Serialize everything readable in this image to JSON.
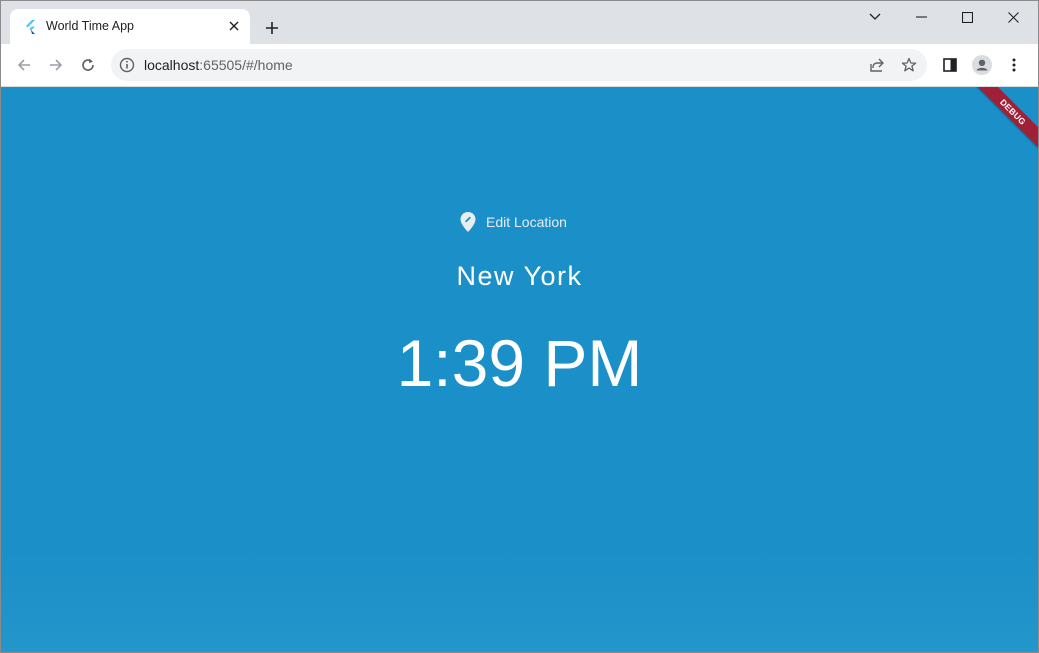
{
  "browser": {
    "tab": {
      "title": "World Time App",
      "favicon": "flutter-icon"
    },
    "new_tab_icon": "plus-icon",
    "window_controls": [
      "chevron-down-icon",
      "minimize-icon",
      "maximize-icon",
      "close-icon"
    ],
    "address": {
      "host": "localhost",
      "path": ":65505/#/home"
    },
    "toolbar_icons": [
      "back-icon",
      "forward-icon",
      "reload-icon",
      "info-icon",
      "share-icon",
      "star-icon",
      "sidepanel-icon",
      "profile-icon",
      "menu-icon"
    ]
  },
  "app": {
    "background_color": "#1b8fc7",
    "debug_banner": "DEBUG",
    "edit_location": {
      "label": "Edit Location",
      "icon": "edit-location-icon"
    },
    "location": "New York",
    "time": "1:39 PM"
  }
}
